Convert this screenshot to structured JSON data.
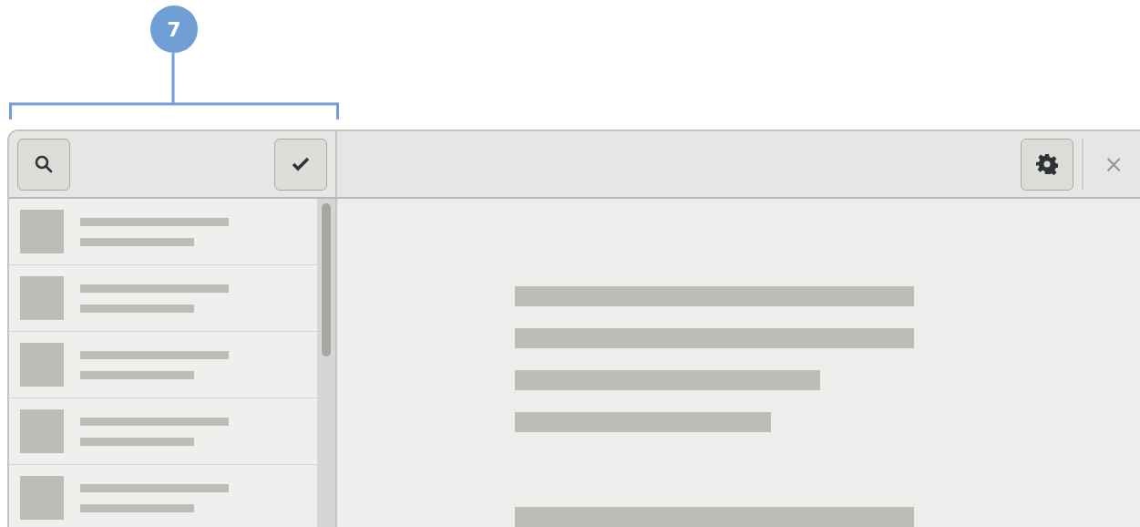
{
  "callout": {
    "number": "7"
  },
  "header": {
    "left_buttons": [
      {
        "kind": "search"
      },
      {
        "kind": "check"
      }
    ],
    "right_buttons": [
      {
        "kind": "settings"
      }
    ],
    "close": "×"
  },
  "sidebar": {
    "rows": [
      {
        "kind": "placeholder"
      },
      {
        "kind": "placeholder"
      },
      {
        "kind": "placeholder"
      },
      {
        "kind": "placeholder"
      },
      {
        "kind": "placeholder"
      }
    ]
  },
  "content": {
    "lines": [
      {
        "kind": "long"
      },
      {
        "kind": "long"
      },
      {
        "kind": "medium"
      },
      {
        "kind": "short"
      },
      {
        "kind": "gap"
      },
      {
        "kind": "long"
      }
    ]
  }
}
